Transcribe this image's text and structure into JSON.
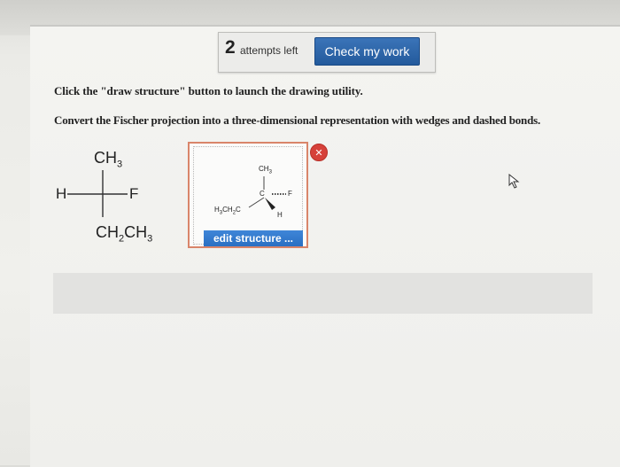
{
  "header": {
    "attempts_count": "2",
    "attempts_label": "attempts left",
    "check_button_label": "Check my work"
  },
  "instructions": {
    "line1": "Click the \"draw structure\" button to launch the drawing utility.",
    "line2": "Convert the Fischer projection into a three-dimensional representation with wedges and dashed bonds."
  },
  "fischer": {
    "top": "CH3",
    "left": "H",
    "right": "F",
    "bottom": "CH2CH3"
  },
  "structure": {
    "top_label": "CH3",
    "center_label": "C",
    "dash_label": "F",
    "left_label": "H3CH2C",
    "wedge_label": "H",
    "edit_button_label": "edit structure ...",
    "close_icon": "close-icon"
  },
  "colors": {
    "accent": "#235a9c",
    "edit_button": "#2a6fc2",
    "close": "#d6413a",
    "box_border": "#d9856a"
  }
}
